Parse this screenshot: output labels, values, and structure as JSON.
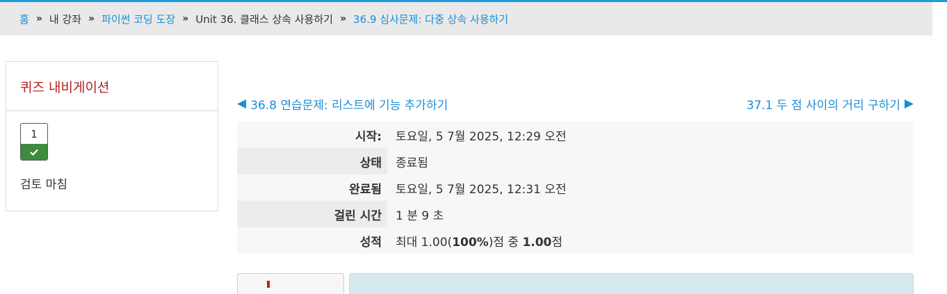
{
  "breadcrumb": {
    "home": "홈",
    "my_courses": "내 강좌",
    "course": "파이썬 코딩 도장",
    "unit": "Unit 36. 클래스 상속 사용하기",
    "current": "36.9 심사문제: 다중 상속 사용하기"
  },
  "quiz_navigation": {
    "title": "퀴즈 내비게이션",
    "question_number": "1",
    "finish_review": "검토 마침"
  },
  "nav_links": {
    "prev": "36.8 연습문제: 리스트에 기능 추가하기",
    "next": "37.1 두 점 사이의 거리 구하기"
  },
  "summary": {
    "started_label": "시작:",
    "started_value": "토요일, 5 7월 2025, 12:29 오전",
    "state_label": "상태",
    "state_value": "종료됨",
    "completed_label": "완료됨",
    "completed_value": "토요일, 5 7월 2025, 12:31 오전",
    "time_label": "걸린 시간",
    "time_value": "1 분 9 초",
    "grade_label": "성적",
    "grade_prefix": "최대 1.00(",
    "grade_percent": "100%",
    "grade_mid": ")점 중 ",
    "grade_score": "1.00",
    "grade_suffix": "점"
  },
  "colors": {
    "accent": "#1a8dd6",
    "quiz_title": "#b22222",
    "correct": "#3d8b3d"
  }
}
